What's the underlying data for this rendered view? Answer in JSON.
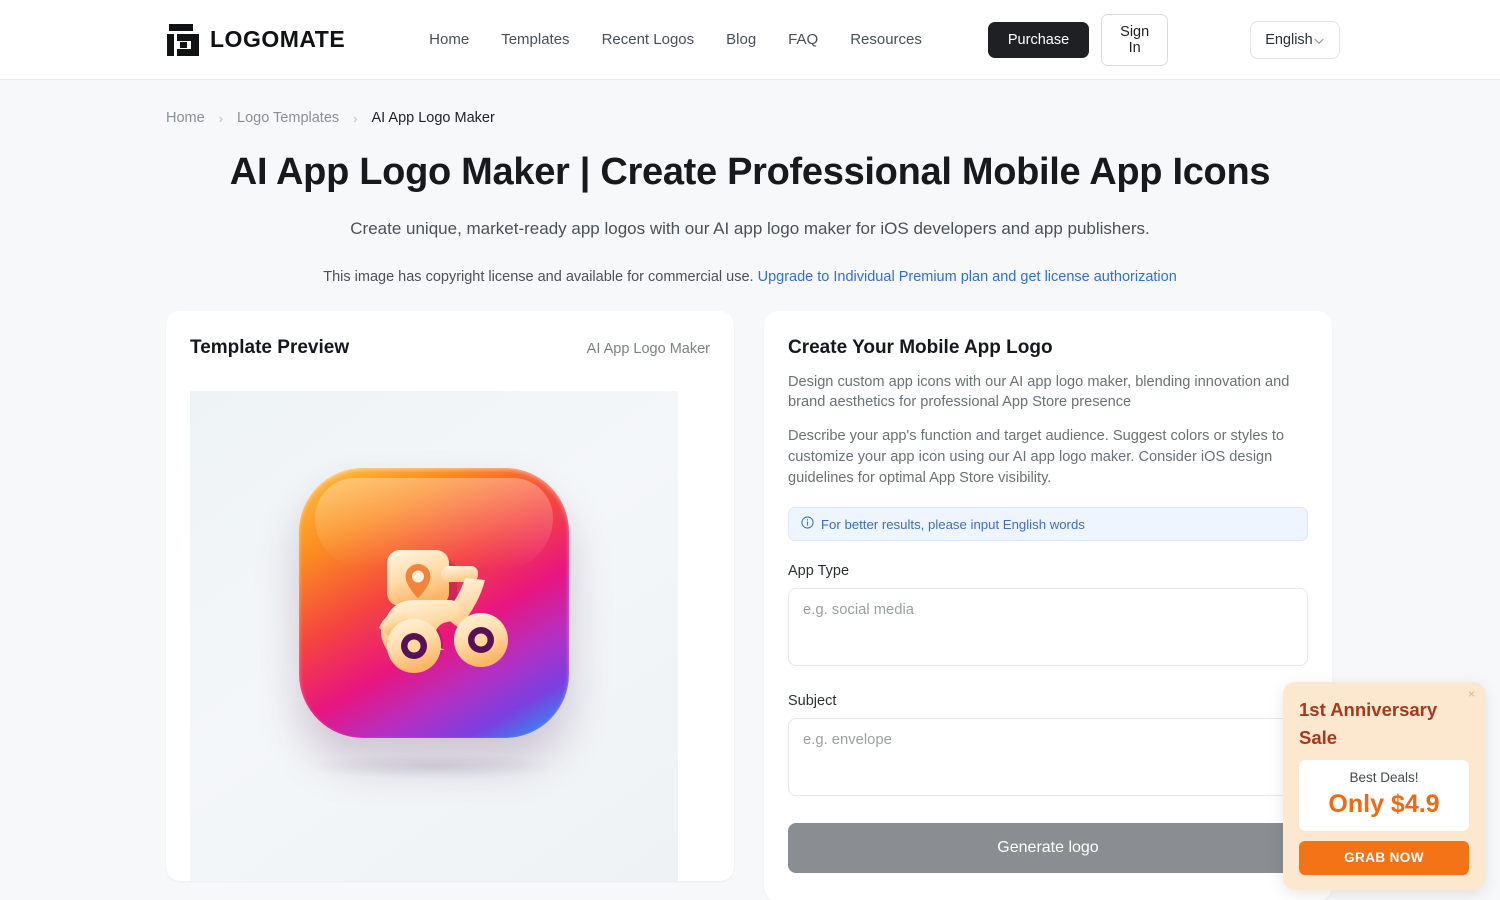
{
  "header": {
    "brand_name": "LOGOMATE",
    "nav": [
      {
        "label": "Home"
      },
      {
        "label": "Templates"
      },
      {
        "label": "Recent Logos"
      },
      {
        "label": "Blog"
      },
      {
        "label": "FAQ"
      },
      {
        "label": "Resources"
      }
    ],
    "purchase_label": "Purchase",
    "signin_label": "Sign In",
    "language": "English"
  },
  "breadcrumb": {
    "home": "Home",
    "section": "Logo Templates",
    "current": "AI App Logo Maker",
    "separator": "›"
  },
  "hero": {
    "title": "AI App Logo Maker | Create Professional Mobile App Icons",
    "subtitle": "Create unique, market-ready app logos with our AI app logo maker for iOS developers and app publishers.",
    "license_text": "This image has copyright license and available for commercial use.",
    "license_link": "Upgrade to Individual Premium plan and get license authorization"
  },
  "preview_panel": {
    "title": "Template Preview",
    "template_name": "AI App Logo Maker",
    "image_alt": "delivery-scooter-app-icon"
  },
  "form_panel": {
    "title": "Create Your Mobile App Logo",
    "description_1": "Design custom app icons with our AI app logo maker, blending innovation and brand aesthetics for professional App Store presence",
    "description_2": "Describe your app's function and target audience. Suggest colors or styles to customize your app icon using our AI app logo maker. Consider iOS design guidelines for optimal App Store visibility.",
    "tip": "For better results, please input English words",
    "app_type_label": "App Type",
    "app_type_value": "",
    "app_type_placeholder": "e.g. social media",
    "subject_label": "Subject",
    "subject_value": "",
    "subject_placeholder": "e.g. envelope",
    "generate_label": "Generate logo"
  },
  "promo": {
    "title": "1st Anniversary Sale",
    "close": "×",
    "best_deals": "Best Deals!",
    "price": "Only $4.9",
    "cta": "GRAB NOW"
  },
  "colors": {
    "accent_link": "#2f6fd8",
    "promo_orange": "#f47316",
    "promo_title": "#a8381b",
    "dark_button": "#1f2024"
  }
}
